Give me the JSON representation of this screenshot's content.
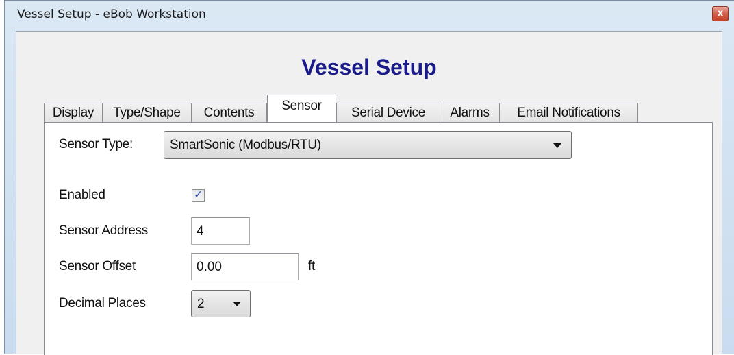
{
  "window": {
    "title": "Vessel Setup - eBob Workstation",
    "close_glyph": "x"
  },
  "dialog": {
    "heading": "Vessel Setup",
    "tabs": [
      {
        "label": "Display",
        "active": false
      },
      {
        "label": "Type/Shape",
        "active": false
      },
      {
        "label": "Contents",
        "active": false
      },
      {
        "label": "Sensor",
        "active": true
      },
      {
        "label": "Serial Device",
        "active": false
      },
      {
        "label": "Alarms",
        "active": false
      },
      {
        "label": "Email Notifications",
        "active": false
      }
    ]
  },
  "sensor": {
    "type_label": "Sensor Type:",
    "type_value": "SmartSonic (Modbus/RTU)",
    "enabled_label": "Enabled",
    "enabled_checked": true,
    "address_label": "Sensor Address",
    "address_value": "4",
    "offset_label": "Sensor Offset",
    "offset_value": "0.00",
    "offset_unit": "ft",
    "decimal_label": "Decimal Places",
    "decimal_value": "2"
  },
  "colors": {
    "heading": "#1a1a8a",
    "checkmark": "#3555b5",
    "close_button": "#c2412a"
  },
  "icons": {
    "close": "close-icon",
    "dropdown": "chevron-down-icon",
    "check": "checkmark-icon"
  }
}
